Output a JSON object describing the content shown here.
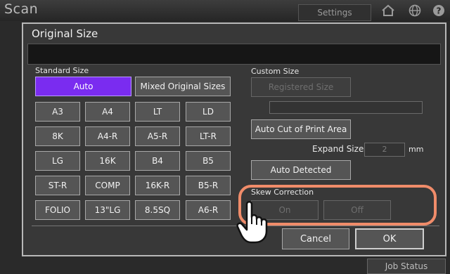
{
  "app": {
    "title": "Scan",
    "settings_label": "Settings",
    "job_status_label": "Job Status"
  },
  "icons": {
    "home": "home-icon",
    "globe": "globe-icon",
    "help": "help-icon",
    "pointer": "hand-pointer-icon"
  },
  "dialog": {
    "title": "Original Size",
    "standard_size_label": "Standard Size",
    "auto_label": "Auto",
    "mixed_label": "Mixed Original Sizes",
    "sizes": [
      "A3",
      "A4",
      "LT",
      "LD",
      "8K",
      "A4-R",
      "A5-R",
      "LT-R",
      "LG",
      "16K",
      "B4",
      "B5",
      "ST-R",
      "COMP",
      "16K-R",
      "B5-R",
      "FOLIO",
      "13\"LG",
      "8.5SQ",
      "A6-R"
    ],
    "custom_size_label": "Custom Size",
    "registered_size_label": "Registered Size",
    "auto_cut_label": "Auto Cut of Print Area",
    "expand_size_label": "Expand Size",
    "expand_size_value": "2",
    "expand_unit": "mm",
    "auto_detected_label": "Auto Detected",
    "skew_correction_label": "Skew Correction",
    "skew_on_label": "On",
    "skew_off_label": "Off",
    "cancel_label": "Cancel",
    "ok_label": "OK"
  },
  "colors": {
    "selected": "#7a2cf0",
    "highlight": "#f08c6a"
  }
}
